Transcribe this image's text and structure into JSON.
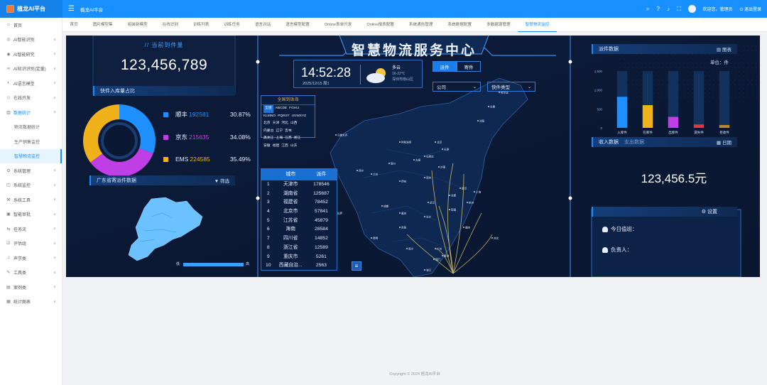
{
  "app": {
    "brand": "植龙AI平台",
    "title": "植龙AI平台"
  },
  "header": {
    "welcome": "欢迎您，管理员",
    "logout": "退出登录"
  },
  "sidebar": {
    "items": [
      {
        "label": "首页",
        "icon": "home-icon",
        "arrow": false
      },
      {
        "label": "AI智能识别",
        "icon": "ai-icon",
        "arrow": true
      },
      {
        "label": "AI智能研究",
        "icon": "research-icon",
        "arrow": true
      },
      {
        "label": "AI知识识别(定量)",
        "icon": "share-icon",
        "arrow": true
      },
      {
        "label": "AI语言模型",
        "icon": "model-icon",
        "arrow": true
      },
      {
        "label": "在线开发",
        "icon": "code-icon",
        "arrow": true
      },
      {
        "label": "数据统计",
        "icon": "chart-icon",
        "arrow": true,
        "active": true
      },
      {
        "label": "物流数据统计",
        "sub": true
      },
      {
        "label": "生产销售监控",
        "sub": true
      },
      {
        "label": "智慧物流监控",
        "sub": true,
        "active": true
      },
      {
        "label": "系统管理",
        "icon": "gear-icon",
        "arrow": true
      },
      {
        "label": "系统监控",
        "icon": "monitor-icon",
        "arrow": true
      },
      {
        "label": "系统工具",
        "icon": "tool-icon",
        "arrow": true
      },
      {
        "label": "智能审批",
        "icon": "approval-icon",
        "arrow": true
      },
      {
        "label": "任务流",
        "icon": "flow-icon",
        "arrow": true
      },
      {
        "label": "评估组",
        "icon": "eval-icon",
        "arrow": true
      },
      {
        "label": "声学类",
        "icon": "sound-icon",
        "arrow": true
      },
      {
        "label": "工具类",
        "icon": "tools-icon",
        "arrow": true
      },
      {
        "label": "案例类",
        "icon": "case-icon",
        "arrow": true
      },
      {
        "label": "统计图表",
        "icon": "stats-icon",
        "arrow": true
      }
    ]
  },
  "tabs": [
    {
      "label": "首页"
    },
    {
      "label": "图片模型集"
    },
    {
      "label": "组装新模型"
    },
    {
      "label": "在线识别"
    },
    {
      "label": "训练列表"
    },
    {
      "label": "训练任务"
    },
    {
      "label": "语言对话"
    },
    {
      "label": "语言模型配置"
    },
    {
      "label": "Online表单开发"
    },
    {
      "label": "Online报表配置"
    },
    {
      "label": "系统通告管理"
    },
    {
      "label": "系统数据配置"
    },
    {
      "label": "多数据源管理"
    },
    {
      "label": "智慧物流监控",
      "active": true
    }
  ],
  "dashboard": {
    "title": "智慧物流服务中心",
    "current_title": "//  当前到件量",
    "current_value": "123,456,789",
    "inbound_title": "快件入库量占比",
    "pie": [
      {
        "name": "顺丰",
        "value": "192581",
        "pct": "30.87%",
        "color": "#1e90ff"
      },
      {
        "name": "京东",
        "value": "215635",
        "pct": "34.08%",
        "color": "#c03ee6"
      },
      {
        "name": "EMS",
        "value": "224585",
        "pct": "35.49%",
        "color": "#f0b21a"
      }
    ],
    "gd_title": "广东省寄派件数据",
    "gd_filter": "筛选",
    "gd_scale_low": "低",
    "gd_scale_high": "高",
    "clock": {
      "time": "14:52:28",
      "date": "2025/12/15  周1",
      "weather": "多云",
      "temp": "16-22℃",
      "location": "深圳市南山区"
    },
    "toggles": {
      "dispatch": "派件",
      "send": "寄件"
    },
    "selects": {
      "company": "公司",
      "type": "快件类型"
    },
    "regions": {
      "title": "全国到珠海",
      "rows": [
        [
          "全国",
          "ABCDE",
          "FGHIJ"
        ],
        [
          "KLMNO",
          "PQRST",
          "UVWXYZ"
        ],
        [
          "北京",
          "天津",
          "河北",
          "山西"
        ],
        [
          "内蒙古",
          "辽宁",
          "吉林"
        ],
        [
          "黑龙江",
          "上海",
          "江苏",
          "浙江"
        ],
        [
          "安徽",
          "福建",
          "江西",
          "山东"
        ]
      ]
    },
    "city_table": {
      "headers": [
        "",
        "城市",
        "派件"
      ],
      "rows": [
        [
          "1",
          "天津市",
          "178546"
        ],
        [
          "2",
          "湖南省",
          "125687"
        ],
        [
          "3",
          "福建省",
          "78452"
        ],
        [
          "4",
          "北京市",
          "57841"
        ],
        [
          "5",
          "江苏省",
          "45879"
        ],
        [
          "6",
          "海南",
          "28584"
        ],
        [
          "7",
          "四川省",
          "14852"
        ],
        [
          "8",
          "浙江省",
          "12589"
        ],
        [
          "9",
          "重庆市",
          "5261"
        ],
        [
          "10",
          "西藏自治...",
          "2563"
        ]
      ]
    },
    "dispatch_title": "派件数据",
    "dispatch_tool": "图表",
    "unit": "单位：件",
    "income_tabs": {
      "income": "收入数据",
      "expense": "支出数据"
    },
    "income_tool": "日期",
    "income_value": "123,456.5元",
    "settings_label": "设置",
    "today_label": "今日值班：",
    "owner_label": "负责人："
  },
  "chart_data": {
    "type": "bar",
    "title": "派件数据",
    "categories": [
      "入库件",
      "在库件",
      "出库件",
      "遗失件",
      "拒收件"
    ],
    "values": [
      820,
      600,
      290,
      90,
      75
    ],
    "colors": [
      "#1e90ff",
      "#f0b21a",
      "#c03ee6",
      "#e23a3a",
      "#b8892a"
    ],
    "ylim": [
      0,
      1500
    ],
    "yticks": [
      "1,500",
      "1,000",
      "500",
      "0"
    ],
    "ylabel": "单位：件"
  },
  "map": {
    "cities": [
      "北京",
      "天津",
      "石家庄",
      "太原",
      "济南",
      "郑州",
      "西安",
      "兰州",
      "西宁",
      "银川",
      "呼和浩特",
      "沈阳",
      "长春",
      "哈尔滨",
      "上海",
      "南京",
      "杭州",
      "合肥",
      "福州",
      "南昌",
      "武汉",
      "长沙",
      "广州",
      "南宁",
      "海口",
      "成都",
      "重庆",
      "贵阳",
      "昆明",
      "拉萨",
      "乌鲁木齐",
      "台北",
      "香港",
      "澳门"
    ]
  },
  "footer": "Copyright © 2024 植龙AI平台"
}
